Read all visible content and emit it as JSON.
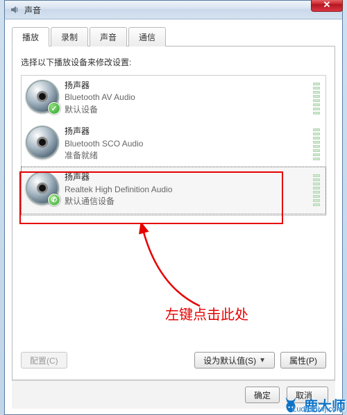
{
  "window": {
    "title": "声音",
    "close_glyph": "✕"
  },
  "tabs": [
    {
      "label": "播放",
      "key": "playback",
      "active": true
    },
    {
      "label": "录制",
      "key": "record",
      "active": false
    },
    {
      "label": "声音",
      "key": "sounds",
      "active": false
    },
    {
      "label": "通信",
      "key": "comm",
      "active": false
    }
  ],
  "instruction": "选择以下播放设备来修改设置:",
  "devices": [
    {
      "name": "扬声器",
      "subtitle": "Bluetooth AV Audio",
      "status": "默认设备",
      "badge": "check",
      "badge_glyph": "✓",
      "selected": false
    },
    {
      "name": "扬声器",
      "subtitle": "Bluetooth SCO Audio",
      "status": "准备就绪",
      "badge": null,
      "badge_glyph": "",
      "selected": false
    },
    {
      "name": "扬声器",
      "subtitle": "Realtek High Definition Audio",
      "status": "默认通信设备",
      "badge": "phone",
      "badge_glyph": "✆",
      "selected": true
    }
  ],
  "buttons": {
    "configure": "配置(C)",
    "set_default": "设为默认值(S)",
    "properties": "属性(P)",
    "ok": "确定",
    "cancel": "取消"
  },
  "annotation": {
    "text": "左键点击此处"
  },
  "watermark": {
    "brand": "鹿大师",
    "url": "Ludashiwj.com"
  }
}
